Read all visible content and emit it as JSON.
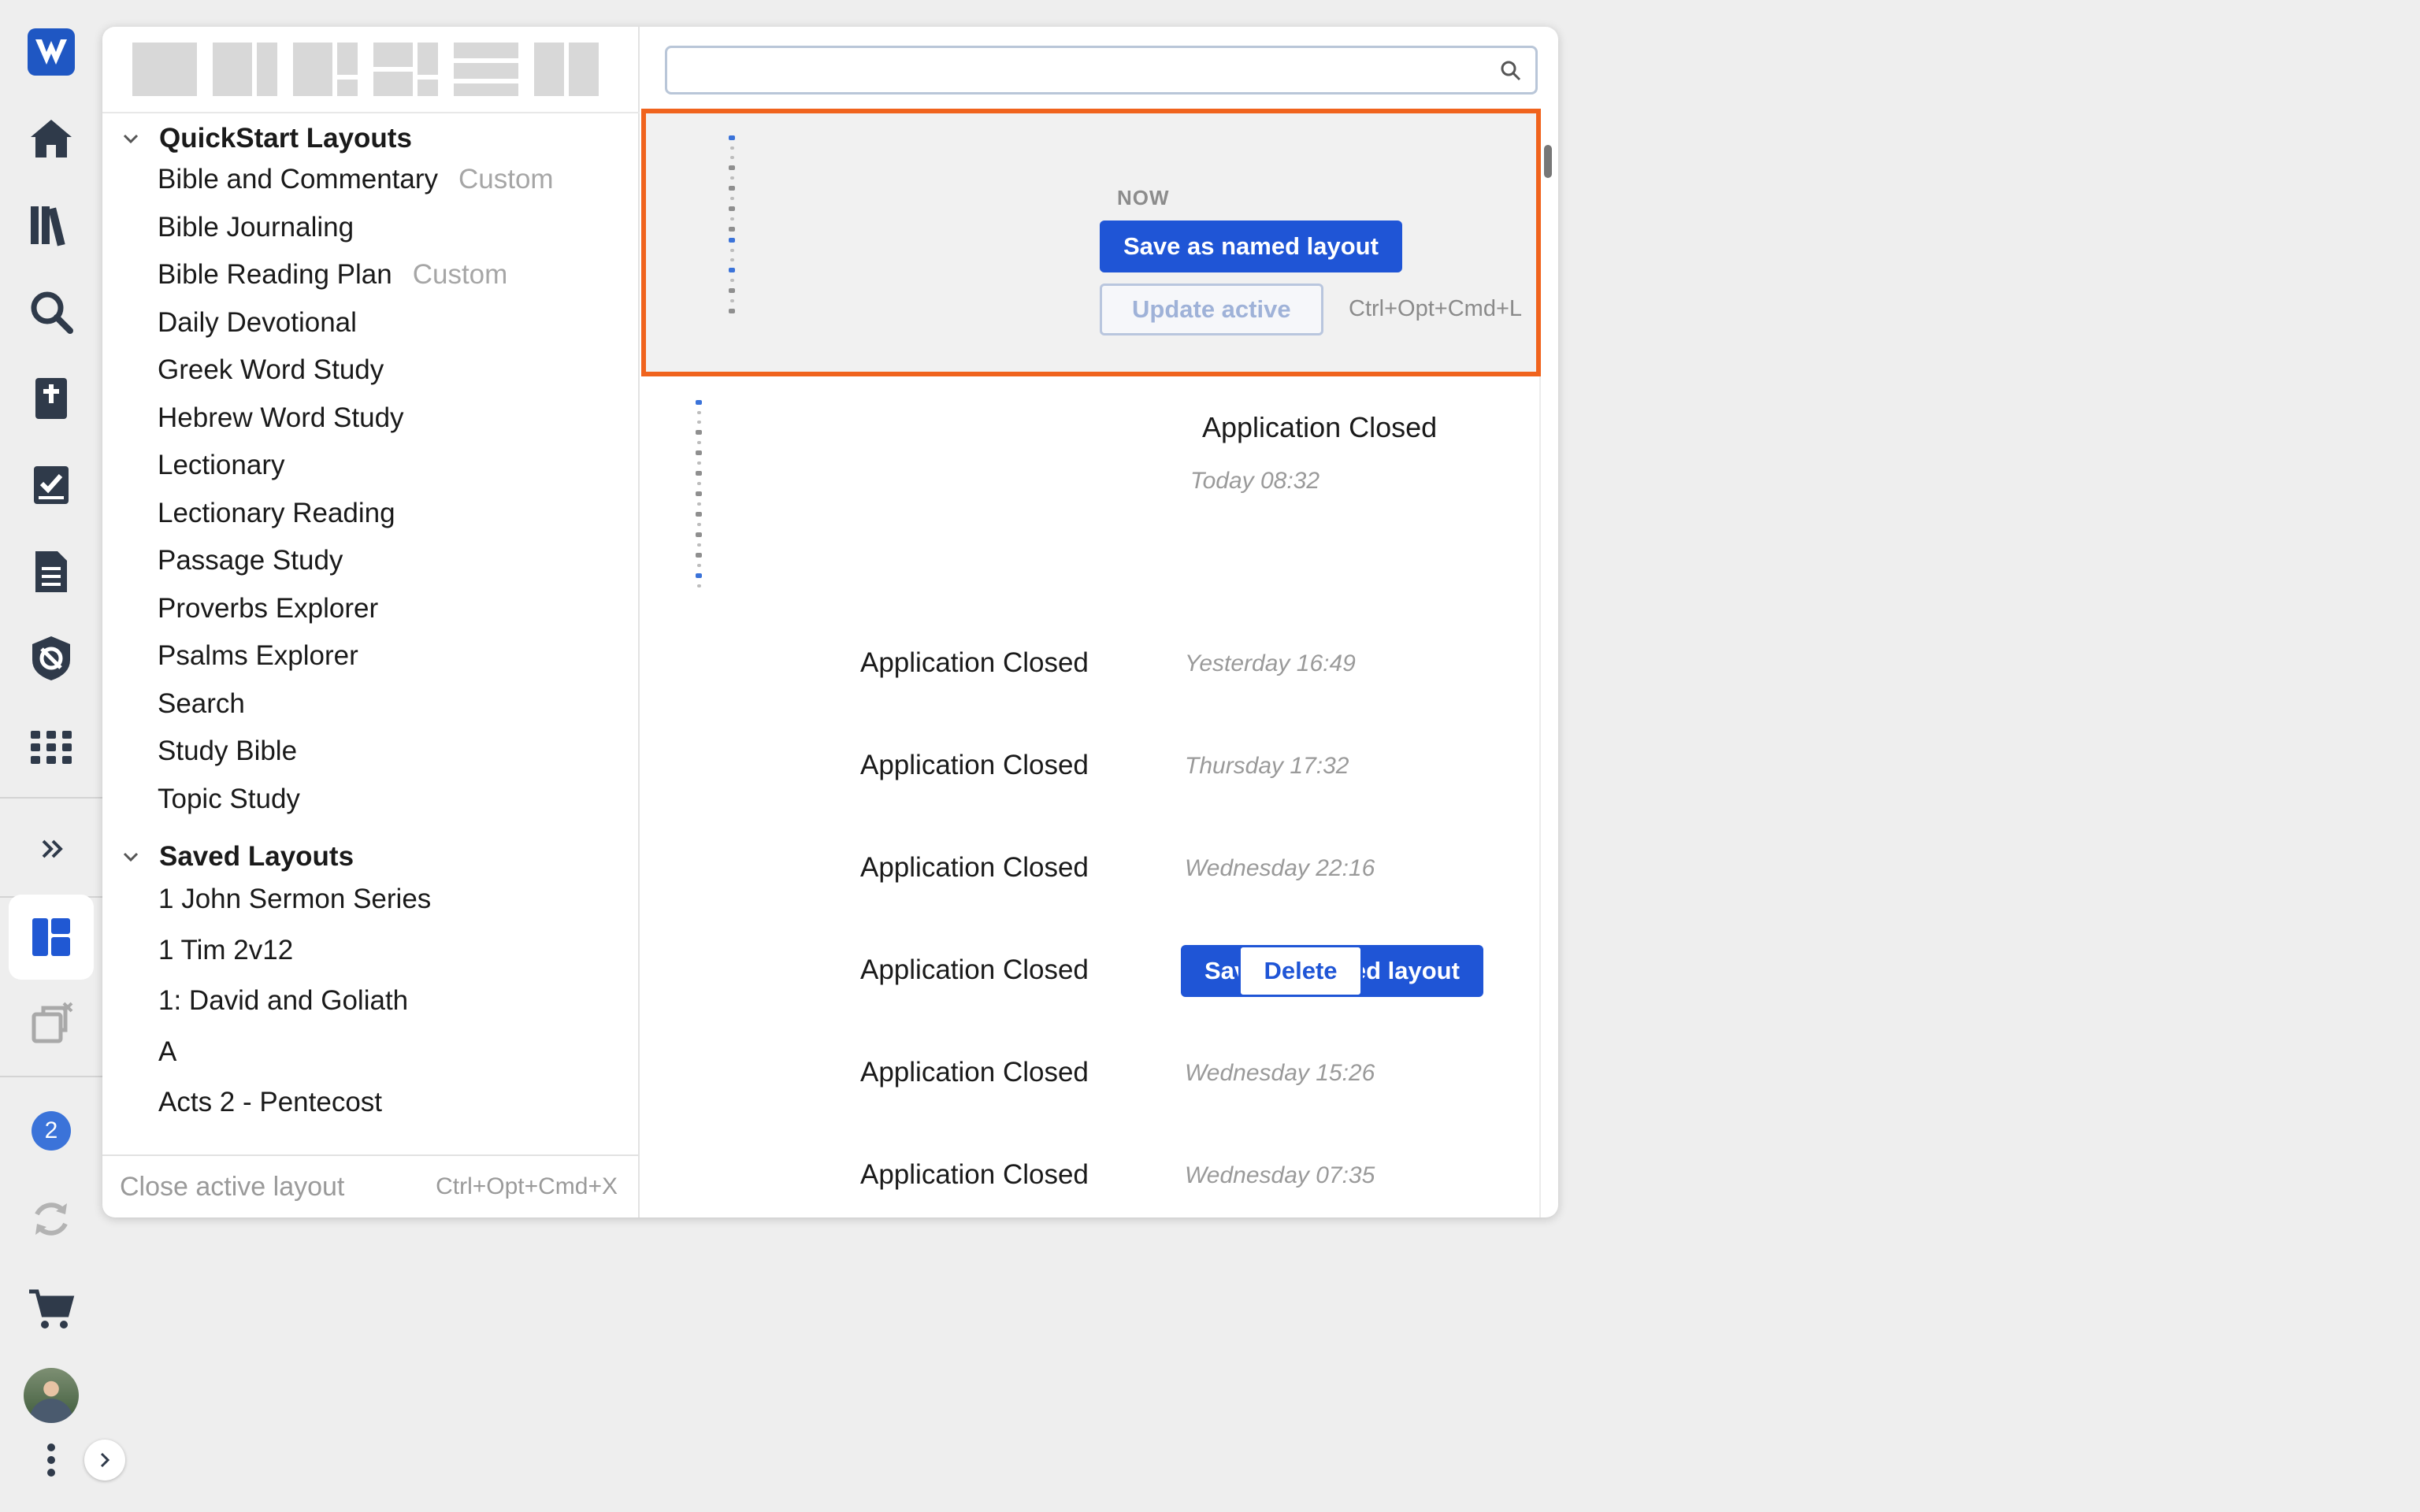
{
  "rail": {
    "items": [
      {
        "name": "logo",
        "icon": "logos-logo-icon"
      },
      {
        "name": "home",
        "icon": "home-icon"
      },
      {
        "name": "library",
        "icon": "library-icon"
      },
      {
        "name": "search",
        "icon": "search-icon"
      },
      {
        "name": "bible",
        "icon": "bible-icon"
      },
      {
        "name": "reading-plans",
        "icon": "checklist-icon"
      },
      {
        "name": "documents",
        "icon": "document-icon"
      },
      {
        "name": "guides",
        "icon": "shield-icon"
      },
      {
        "name": "tools",
        "icon": "apps-grid-icon"
      },
      {
        "name": "more",
        "icon": "double-chevron-right-icon"
      },
      {
        "name": "layouts",
        "icon": "layouts-icon",
        "active": true
      },
      {
        "name": "close-layout",
        "icon": "close-layout-icon"
      },
      {
        "name": "notifications",
        "icon": "badge-icon"
      },
      {
        "name": "sync",
        "icon": "sync-icon"
      },
      {
        "name": "store",
        "icon": "cart-icon"
      },
      {
        "name": "account",
        "icon": "avatar"
      },
      {
        "name": "menu",
        "icon": "vertical-dots-icon"
      }
    ],
    "notification_count": "2"
  },
  "panel": {
    "search": {
      "value": "",
      "placeholder": ""
    },
    "quickstart": {
      "title": "QuickStart Layouts",
      "items": [
        {
          "label": "Bible and Commentary",
          "tag": "Custom"
        },
        {
          "label": "Bible Journaling",
          "tag": ""
        },
        {
          "label": "Bible Reading Plan",
          "tag": "Custom"
        },
        {
          "label": "Daily Devotional",
          "tag": ""
        },
        {
          "label": "Greek Word Study",
          "tag": ""
        },
        {
          "label": "Hebrew Word Study",
          "tag": ""
        },
        {
          "label": "Lectionary",
          "tag": ""
        },
        {
          "label": "Lectionary Reading",
          "tag": ""
        },
        {
          "label": "Passage Study",
          "tag": ""
        },
        {
          "label": "Proverbs Explorer",
          "tag": ""
        },
        {
          "label": "Psalms Explorer",
          "tag": ""
        },
        {
          "label": "Search",
          "tag": ""
        },
        {
          "label": "Study Bible",
          "tag": ""
        },
        {
          "label": "Topic Study",
          "tag": ""
        }
      ]
    },
    "saved": {
      "title": "Saved Layouts",
      "items": [
        {
          "label": "1 John Sermon Series"
        },
        {
          "label": "1 Tim 2v12"
        },
        {
          "label": "1: David and Goliath"
        },
        {
          "label": "A"
        },
        {
          "label": "Acts 2 - Pentecost"
        }
      ]
    },
    "footer": {
      "close_label": "Close active layout",
      "close_shortcut": "Ctrl+Opt+Cmd+X"
    },
    "current": {
      "label": "NOW",
      "save_label": "Save as named layout",
      "update_label": "Update active",
      "update_shortcut": "Ctrl+Opt+Cmd+L",
      "accent_color": "#f0631d"
    },
    "recent": {
      "name": "Application Closed",
      "time": "Today 08:32"
    },
    "history": [
      {
        "name": "Application Closed",
        "time": "Yesterday 16:49"
      },
      {
        "name": "Application Closed",
        "time": "Thursday 17:32"
      },
      {
        "name": "Application Closed",
        "time": "Wednesday 22:16"
      },
      {
        "name": "Application Closed",
        "time": "",
        "hover": true,
        "save_label": "Save as named layout",
        "delete_label": "Delete"
      },
      {
        "name": "Application Closed",
        "time": "Wednesday 15:26"
      },
      {
        "name": "Application Closed",
        "time": "Wednesday 07:35"
      }
    ]
  }
}
